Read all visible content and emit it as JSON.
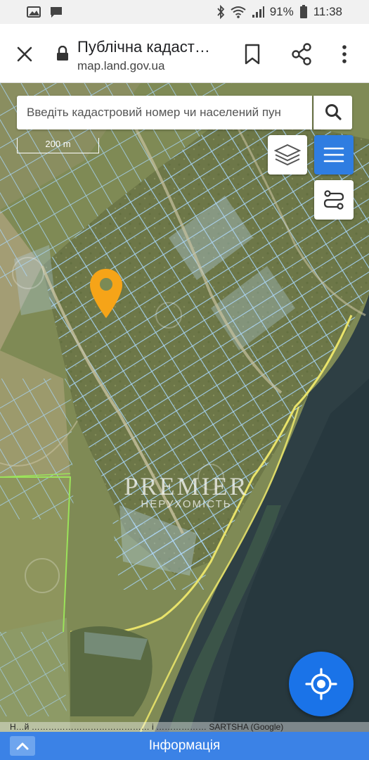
{
  "status_bar": {
    "battery_percent": "91%",
    "time": "11:38",
    "left_icons": [
      "image-icon",
      "message-icon"
    ],
    "right_icons": [
      "bluetooth-icon",
      "wifi-icon",
      "signal-icon",
      "battery-icon"
    ]
  },
  "browser": {
    "title": "Публічна кадаст…",
    "url": "map.land.gov.ua"
  },
  "map": {
    "search_placeholder": "Введіть кадастровий номер чи населений пун",
    "scale_label": "200 m",
    "watermark_title": "PREMIER",
    "watermark_subtitle": "НЕРУХОМІСТЬ",
    "attribution": "Н…й …………………………………… і ……………… SARTSHA (Google)"
  },
  "bottom_bar": {
    "label": "Інформація"
  },
  "colors": {
    "primary_blue": "#2f7de1",
    "info_bar_blue": "#3b82e6",
    "parcel_outline": "#9fd3ff",
    "road_yellow": "#e9e36a",
    "pin_orange": "#f6a418"
  }
}
